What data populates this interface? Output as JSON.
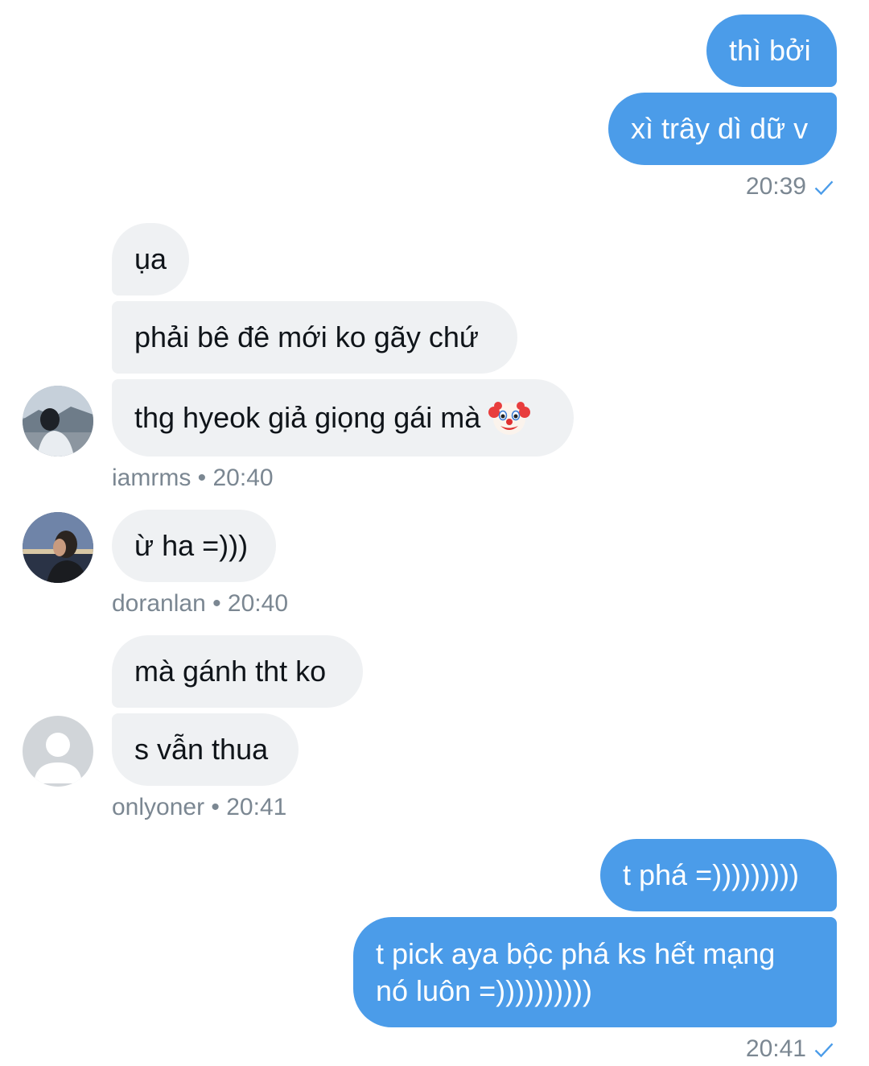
{
  "colors": {
    "outgoing_bubble": "#4b9ce9",
    "incoming_bubble": "#eff1f3",
    "meta_text": "#7b8792",
    "read_check": "#4b9ce9"
  },
  "messages": {
    "out1": {
      "text": "thì bởi"
    },
    "out2": {
      "text": "xì trây dì dữ v"
    },
    "out_group1_time": "20:39",
    "in1": {
      "text": "ụa"
    },
    "in2": {
      "text": "phải bê đê mới ko gãy chứ"
    },
    "in3": {
      "text": "thg hyeok giả giọng gái mà",
      "emoji": "clown-face-icon"
    },
    "in_group1_meta": "iamrms • 20:40",
    "in4": {
      "text": "ừ ha =)))"
    },
    "in_group2_meta": "doranlan • 20:40",
    "in5": {
      "text": "mà gánh tht ko"
    },
    "in6": {
      "text": "s vẫn thua"
    },
    "in_group3_meta": "onlyoner • 20:41",
    "out3": {
      "text": "t phá =)))))))))"
    },
    "out4": {
      "line1": "t pick aya bộc phá ks hết mạng",
      "line2": "nó luôn =))))))))))"
    },
    "out_group2_time": "20:41"
  },
  "avatars": {
    "iamrms": "photo-avatar",
    "doranlan": "photo-avatar",
    "onlyoner": "default-user-avatar"
  }
}
